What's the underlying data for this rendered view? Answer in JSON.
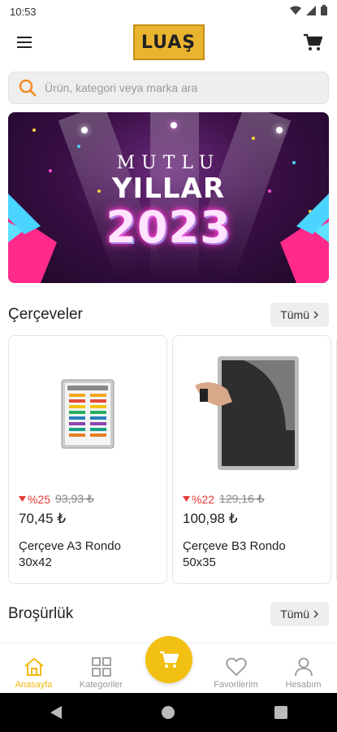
{
  "status": {
    "time": "10:53"
  },
  "header": {
    "logo_text": "LUAŞ"
  },
  "search": {
    "placeholder": "Ürün, kategori veya marka ara"
  },
  "banner": {
    "line1": "MUTLU",
    "line2": "YILLAR",
    "line3": "2023"
  },
  "sections": [
    {
      "title": "Çerçeveler",
      "see_all": "Tümü",
      "products": [
        {
          "discount": "%25",
          "old_price": "93,93 ₺",
          "price": "70,45 ₺",
          "name": "Çerçeve A3 Rondo 30x42"
        },
        {
          "discount": "%22",
          "old_price": "129,16 ₺",
          "price": "100,98 ₺",
          "name": "Çerçeve B3 Rondo 50x35"
        }
      ]
    },
    {
      "title": "Broşürlük",
      "see_all": "Tümü"
    }
  ],
  "bottom_nav": {
    "home": "Anasayfa",
    "categories": "Kategoriler",
    "favorites": "Favorilerim",
    "account": "Hesabım"
  },
  "colors": {
    "accent": "#f2c012",
    "discount": "#e53935",
    "active_nav": "#f2b90f"
  },
  "icons": [
    "menu-icon",
    "cart-icon",
    "search-icon",
    "home-icon",
    "grid-icon",
    "heart-icon",
    "user-icon",
    "back-icon",
    "home-circle-icon",
    "recent-apps-icon"
  ]
}
